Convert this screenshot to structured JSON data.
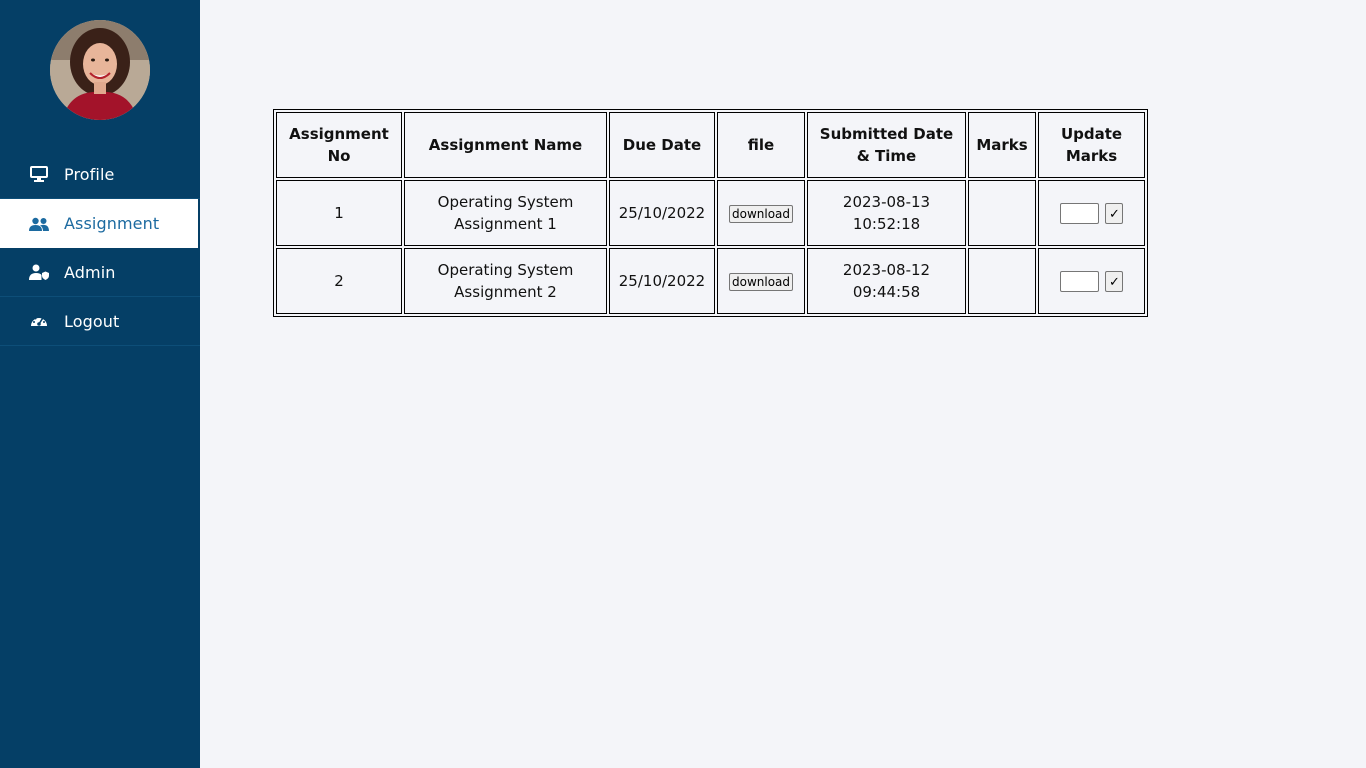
{
  "sidebar": {
    "items": [
      {
        "label": "Profile",
        "icon": "monitor-icon",
        "active": false
      },
      {
        "label": "Assignment",
        "icon": "users-icon",
        "active": true
      },
      {
        "label": "Admin",
        "icon": "user-shield-icon",
        "active": false
      },
      {
        "label": "Logout",
        "icon": "gauge-icon",
        "active": false
      }
    ]
  },
  "table": {
    "headers": [
      "Assignment No",
      "Assignment Name",
      "Due Date",
      "file",
      "Submitted Date & Time",
      "Marks",
      "Update Marks"
    ],
    "rows": [
      {
        "no": "1",
        "name": "Operating System Assignment 1",
        "due": "25/10/2022",
        "file_button": "download",
        "submitted": "2023-08-13 10:52:18",
        "marks": "",
        "update_input": "",
        "update_button": "✓"
      },
      {
        "no": "2",
        "name": "Operating System Assignment 2",
        "due": "25/10/2022",
        "file_button": "download",
        "submitted": "2023-08-12 09:44:58",
        "marks": "",
        "update_input": "",
        "update_button": "✓"
      }
    ]
  },
  "colors": {
    "sidebar_bg": "#053f66",
    "active_text": "#1c6aa0",
    "page_bg": "#f4f5f9"
  }
}
